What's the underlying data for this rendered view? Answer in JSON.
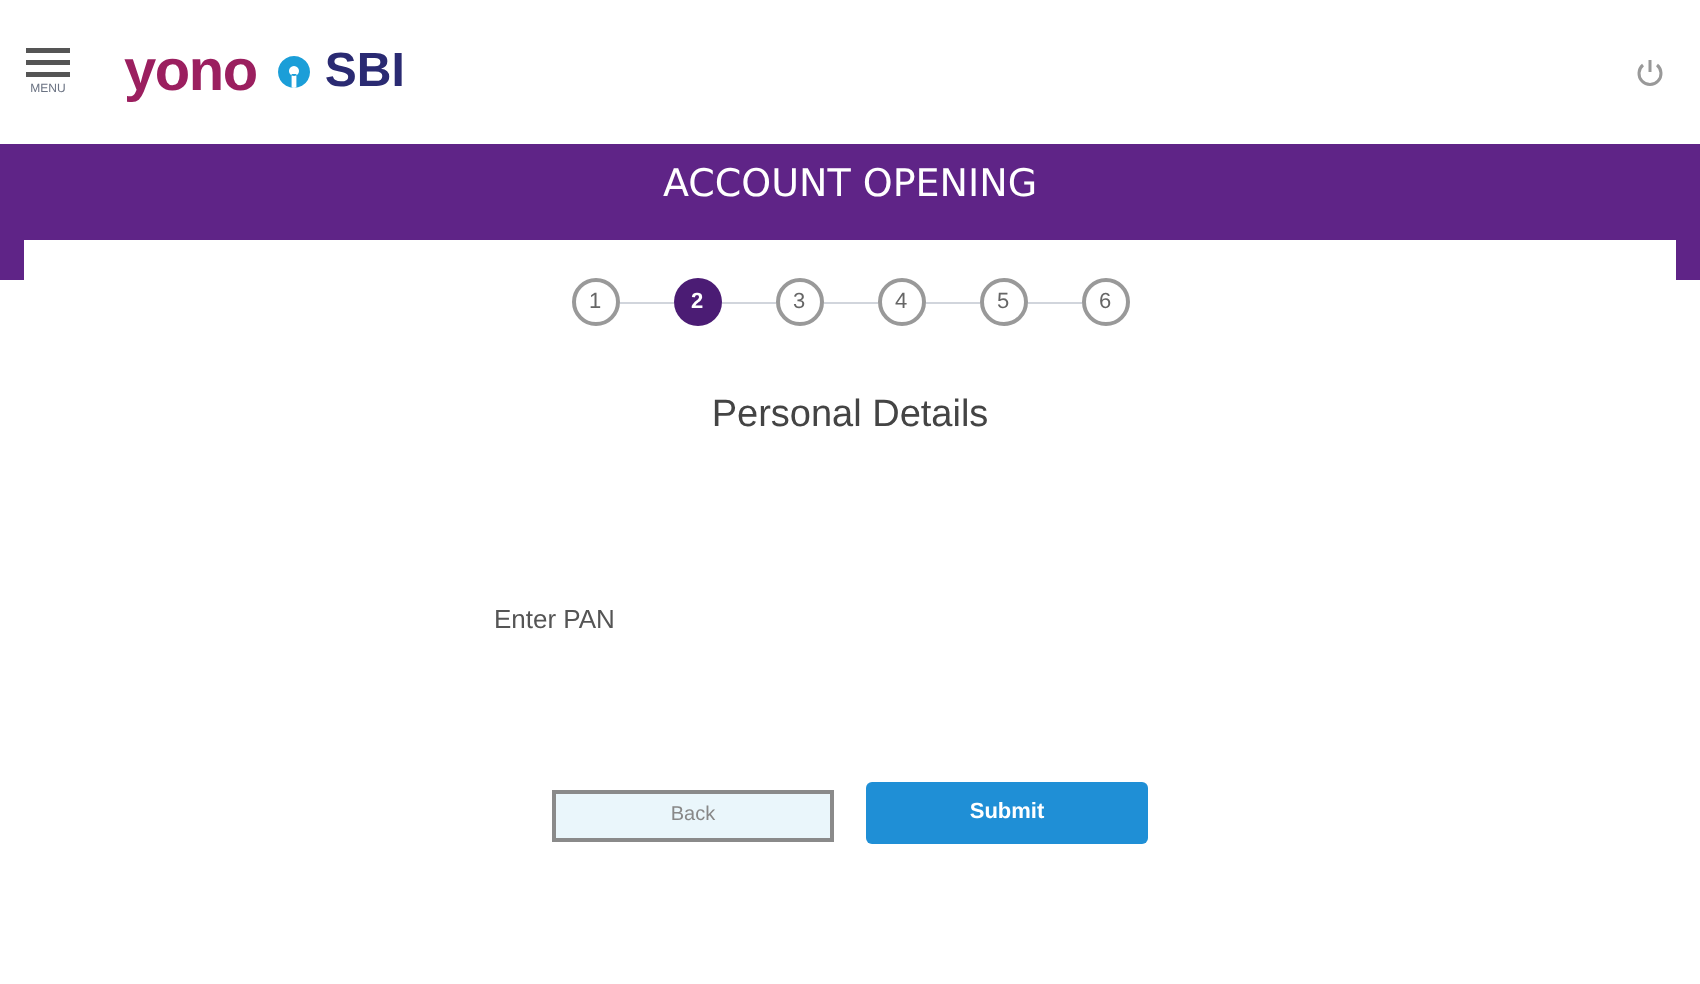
{
  "header": {
    "menu_label": "MENU",
    "logo_left": "yono",
    "logo_right": "SBI"
  },
  "banner": {
    "title": "ACCOUNT OPENING"
  },
  "steps": [
    {
      "label": "1",
      "selected": false
    },
    {
      "label": "2",
      "selected": true
    },
    {
      "label": "3",
      "selected": false
    },
    {
      "label": "4",
      "selected": false
    },
    {
      "label": "5",
      "selected": false
    },
    {
      "label": "6",
      "selected": false
    }
  ],
  "section_title": "Personal Details",
  "pan_field": {
    "placeholder": "Enter PAN"
  },
  "buttons": [
    {
      "label": "Back",
      "kind": "secondary"
    },
    {
      "label": "Submit",
      "kind": "primary"
    }
  ]
}
